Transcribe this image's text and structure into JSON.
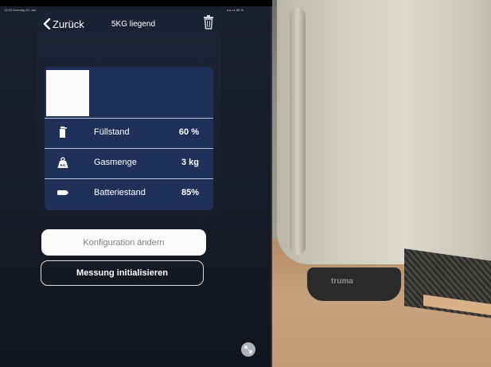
{
  "status_bar": {
    "time_date": "12:09  Sonntag 19. Jan.",
    "indicators": "◂ ▴ • ▸ 85 %"
  },
  "header": {
    "back_label": "Zurück",
    "title": "5KG liegend"
  },
  "card": {
    "fill_level_fraction": 0.26,
    "rows": [
      {
        "icon": "gas-bottle-icon",
        "label": "Füllstand",
        "value": "60 %"
      },
      {
        "icon": "weight-icon",
        "label": "Gasmenge",
        "value": "3 kg"
      },
      {
        "icon": "battery-icon",
        "label": "Batteriestand",
        "value": "85%"
      }
    ]
  },
  "buttons": {
    "configure": "Konfiguration ändern",
    "initialize": "Messung initialisieren"
  },
  "photo": {
    "sensor_brand": "truma"
  },
  "colors": {
    "card_background": "#1f3158",
    "screen_background": "#161b27",
    "fill": "#fafafa"
  }
}
